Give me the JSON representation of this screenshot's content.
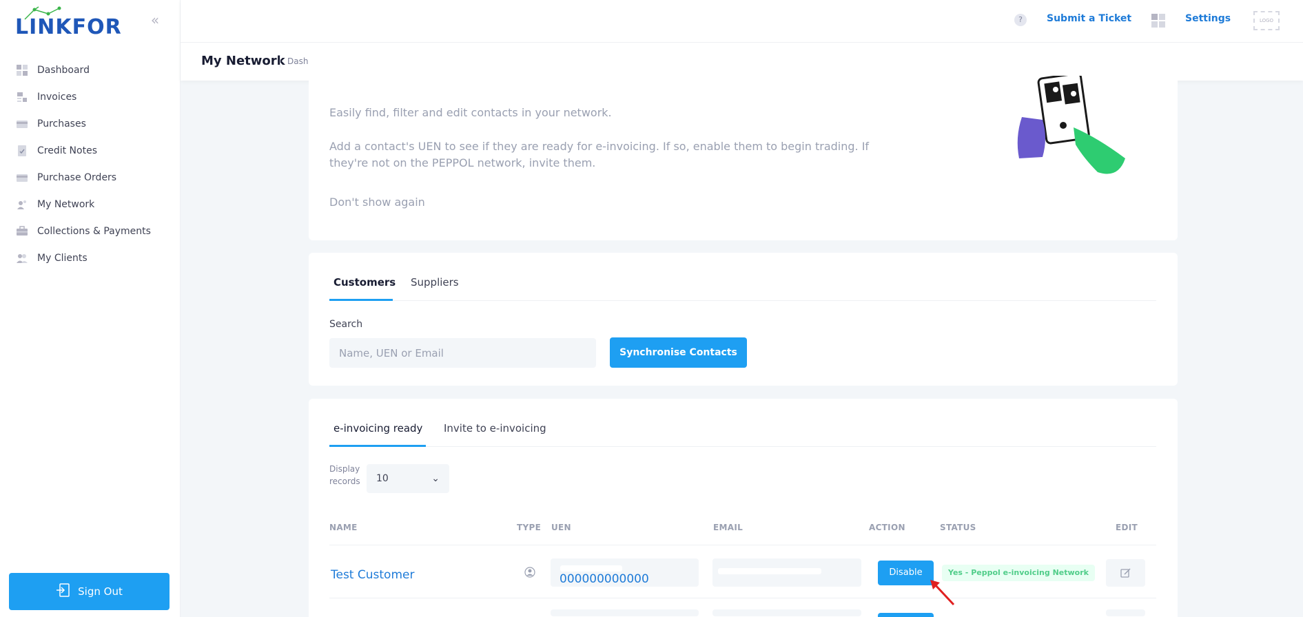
{
  "brand": {
    "name": "LINKFOR",
    "color": "#1f57b8",
    "accent": "#1e9ff2"
  },
  "sidebar": {
    "collapse_icon": "double-chevron-left-icon",
    "items": [
      {
        "label": "Dashboard",
        "icon": "dashboard-icon"
      },
      {
        "label": "Invoices",
        "icon": "invoice-icon"
      },
      {
        "label": "Purchases",
        "icon": "card-icon"
      },
      {
        "label": "Credit Notes",
        "icon": "document-check-icon"
      },
      {
        "label": "Purchase Orders",
        "icon": "card-icon"
      },
      {
        "label": "My Network",
        "icon": "network-icon"
      },
      {
        "label": "Collections & Payments",
        "icon": "briefcase-icon"
      },
      {
        "label": "My Clients",
        "icon": "users-icon"
      }
    ],
    "sign_out_label": "Sign Out"
  },
  "header": {
    "help_glyph": "?",
    "submit_ticket": "Submit a Ticket",
    "settings": "Settings",
    "logo_placeholder": "LOGO",
    "page_title": "My Network",
    "breadcrumb": "Dashboard - My Network"
  },
  "info": {
    "line1": "Easily find, filter and edit contacts in your network.",
    "line2": "Add a contact's UEN to see if they are ready for e-invoicing. If so, enable them to begin trading. If they're not on the PEPPOL network, invite them.",
    "dont_show": "Don't show again"
  },
  "contacts_tabs": {
    "customers": "Customers",
    "suppliers": "Suppliers"
  },
  "search": {
    "label": "Search",
    "placeholder": "Name, UEN or Email",
    "sync_button": "Synchronise Contacts"
  },
  "network_tabs": {
    "ready": "e-invoicing ready",
    "invite": "Invite to e-invoicing"
  },
  "display": {
    "label_line1": "Display",
    "label_line2": "records",
    "value": "10"
  },
  "table": {
    "columns": [
      "NAME",
      "TYPE",
      "UEN",
      "EMAIL",
      "ACTION",
      "STATUS",
      "EDIT"
    ],
    "rows": [
      {
        "name": "Test Customer",
        "type_icon": "user-circle-icon",
        "uen": "000000000000",
        "email": "",
        "action": "Disable",
        "status": "Yes - Peppol e-invoicing Network"
      }
    ]
  }
}
